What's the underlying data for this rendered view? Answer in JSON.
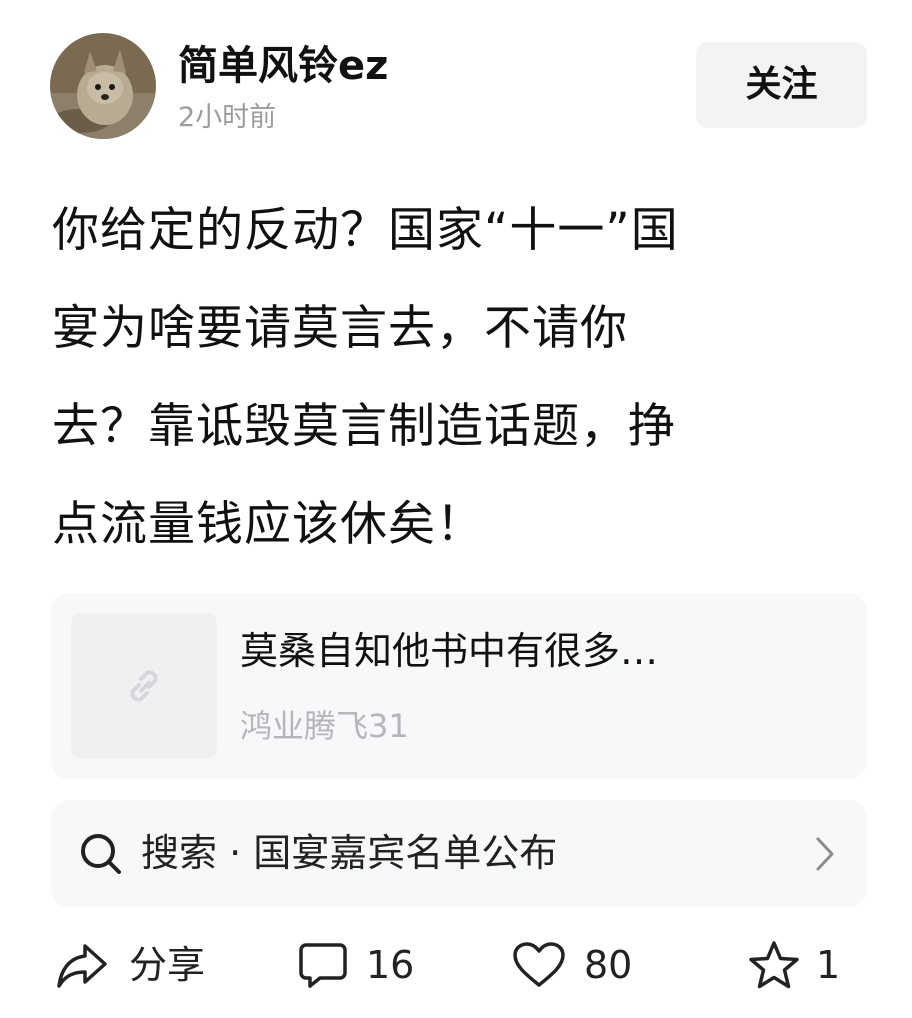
{
  "post": {
    "author": "简单风铃ez",
    "time": "2小时前",
    "follow_label": "关注",
    "avatar_icon": "avatar-animal-photo",
    "lines": [
      "你给定的反动？国家“十一”国",
      "宴为啥要请莫言去，不请你",
      "去？靠诋毁莫言制造话题，挣",
      "点流量钱应该休矣！"
    ]
  },
  "link_card": {
    "thumb_icon": "link-icon",
    "title": "莫桑自知他书中有很多…",
    "author": "鸿业腾飞31"
  },
  "search": {
    "icon": "search-icon",
    "text": "搜索 · 国宴嘉宾名单公布",
    "chevron": "chevron-right-icon"
  },
  "actions": {
    "share_label": "分享",
    "comment_count": "16",
    "like_count": "80",
    "favorite_count": "1"
  },
  "colors": {
    "text": "#111111",
    "muted": "#9c9c9c",
    "card_bg": "#f7f8fa",
    "button_bg": "#f3f3f3"
  }
}
